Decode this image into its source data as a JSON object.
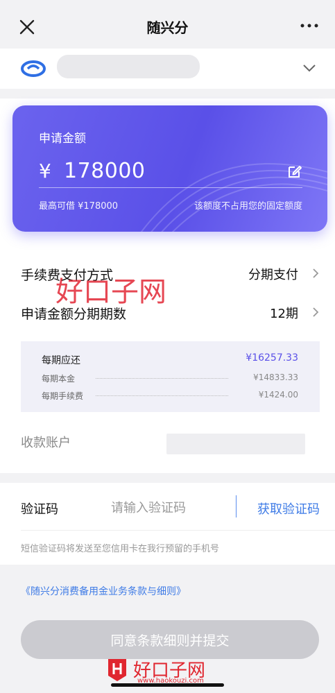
{
  "nav": {
    "title": "随兴分"
  },
  "card": {
    "label": "申请金额",
    "currency": "¥",
    "amount": "178000",
    "limit_text": "最高可借 ¥178000",
    "note_text": "该额度不占用您的固定额度"
  },
  "options": [
    {
      "label": "手续费支付方式",
      "value": "分期支付"
    },
    {
      "label": "申请金额分期期数",
      "value": "12期"
    }
  ],
  "repayment": {
    "title": "每期应还",
    "total": "¥16257.33",
    "principal_label": "每期本金",
    "principal_value": "¥14833.33",
    "fee_label": "每期手续费",
    "fee_value": "¥1424.00"
  },
  "receiving": {
    "label": "收款账户"
  },
  "verify": {
    "label": "验证码",
    "placeholder": "请输入验证码",
    "get_code": "获取验证码",
    "hint": "短信验证码将发送至您信用卡在我行预留的手机号"
  },
  "terms_link": "《随兴分消费备用金业务条款与细则》",
  "submit_label": "同意条款细则并提交",
  "watermark": {
    "mid_text": "好口子网",
    "bottom_text": "好口子网",
    "bottom_url": "www.haokouzi.com"
  },
  "colors": {
    "accent": "#5a50e8",
    "link": "#3e7be6",
    "button_disabled": "#cbcbd0",
    "watermark": "#e0262f"
  },
  "icons": [
    "close-icon",
    "more-icon",
    "bank-logo-icon",
    "chevron-down-icon",
    "edit-icon",
    "chevron-right-icon"
  ]
}
